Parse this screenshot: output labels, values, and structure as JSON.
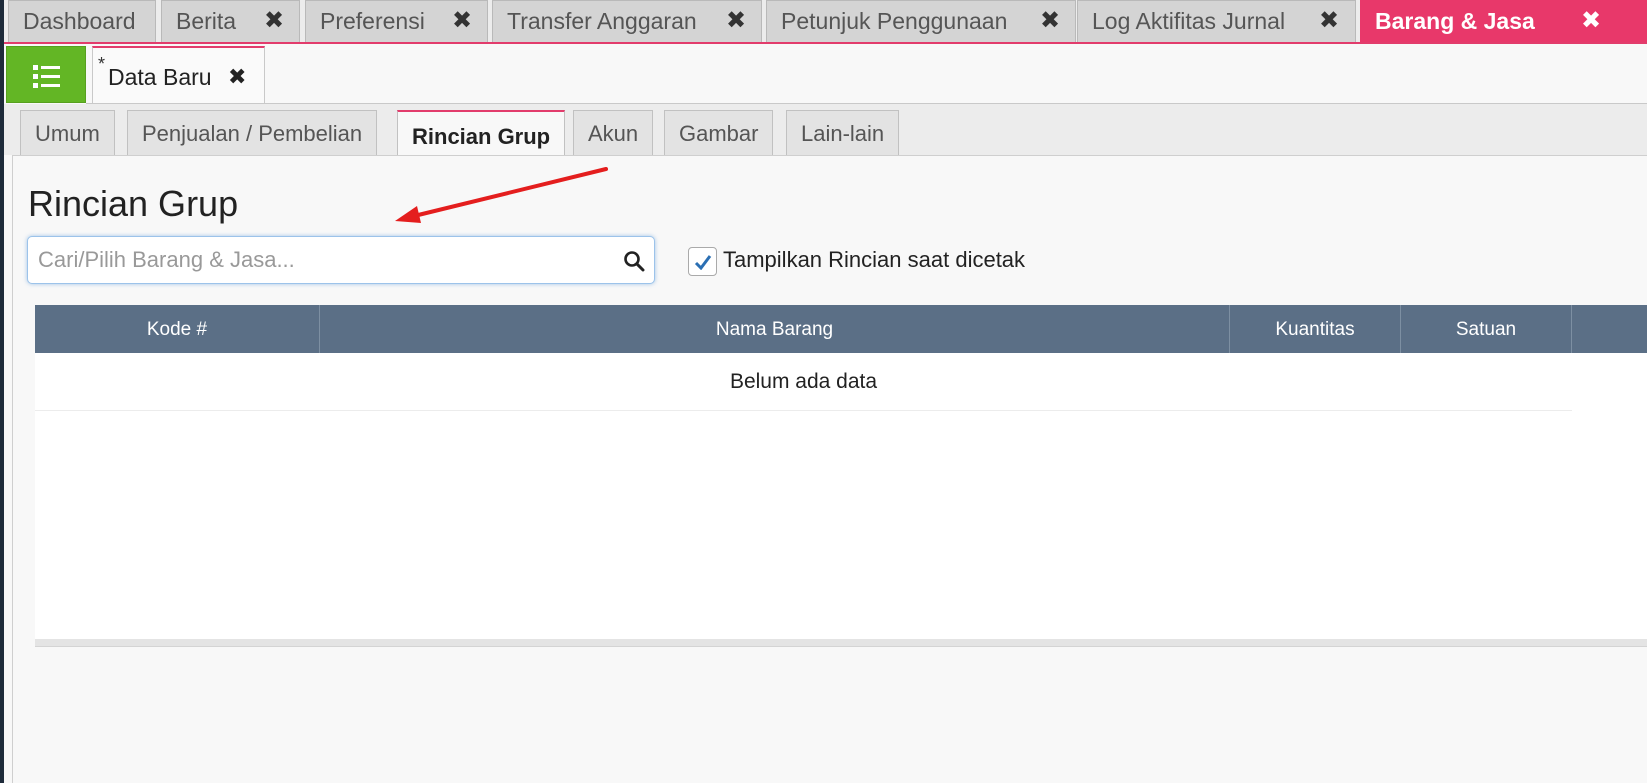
{
  "top_tabs": [
    {
      "label": "Dashboard",
      "closable": false,
      "active": false
    },
    {
      "label": "Berita",
      "closable": true,
      "active": false
    },
    {
      "label": "Preferensi",
      "closable": true,
      "active": false
    },
    {
      "label": "Transfer Anggaran",
      "closable": true,
      "active": false
    },
    {
      "label": "Petunjuk Penggunaan",
      "closable": true,
      "active": false
    },
    {
      "label": "Log Aktifitas Jurnal",
      "closable": true,
      "active": false
    },
    {
      "label": "Barang & Jasa",
      "closable": true,
      "active": true
    }
  ],
  "close_glyph": "✖",
  "doc_tab": {
    "modified_marker": "*",
    "label": "Data Baru"
  },
  "section_tabs": [
    "Umum",
    "Penjualan / Pembelian",
    "Rincian Grup",
    "Akun",
    "Gambar",
    "Lain-lain"
  ],
  "active_section": "Rincian Grup",
  "panel": {
    "title": "Rincian Grup",
    "search_placeholder": "Cari/Pilih Barang & Jasa...",
    "search_value": "",
    "print_details_checked": true,
    "print_details_label": "Tampilkan Rincian saat dicetak"
  },
  "table": {
    "columns": [
      "Kode #",
      "Nama Barang",
      "Kuantitas",
      "Satuan"
    ],
    "empty_message": "Belum ada data"
  },
  "colors": {
    "accent_pink": "#e8386a",
    "menu_green": "#63b625",
    "table_header": "#5b6f86",
    "annotation_arrow": "#e41e1e"
  },
  "icons": {
    "menu": "list-icon",
    "close": "close-icon",
    "search": "search-icon",
    "checkbox": "check-icon"
  }
}
